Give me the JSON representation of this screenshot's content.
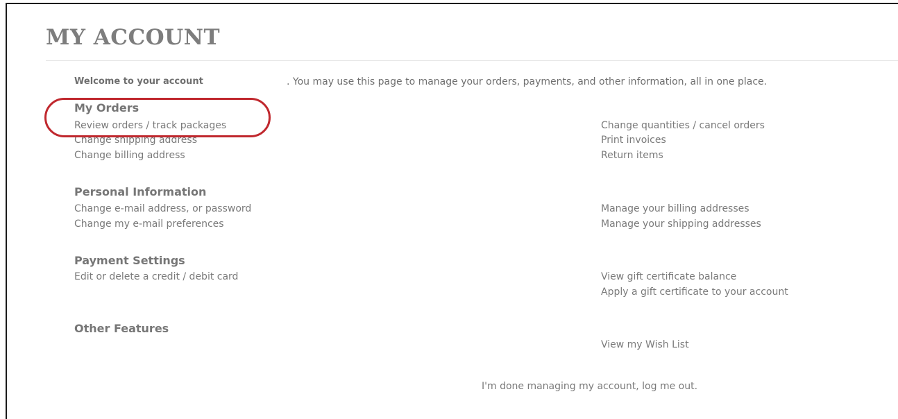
{
  "page": {
    "title": "MY ACCOUNT",
    "welcome_label": "Welcome to your account",
    "welcome_text": ". You may use this page to manage your orders, payments, and other information, all in one place."
  },
  "sections": {
    "orders": {
      "heading": "My Orders",
      "left": [
        "Review orders / track packages",
        "Change shipping address",
        "Change billing address"
      ],
      "right": [
        "Change quantities / cancel orders",
        "Print invoices",
        "Return items"
      ]
    },
    "personal": {
      "heading": "Personal Information",
      "left": [
        "Change e-mail address, or password",
        "Change my e-mail preferences"
      ],
      "right": [
        "Manage your billing addresses",
        "Manage your shipping addresses"
      ]
    },
    "payment": {
      "heading": "Payment Settings",
      "left": [
        "Edit or delete a credit / debit card"
      ],
      "right": [
        "View gift certificate balance",
        "Apply a gift certificate to your account"
      ]
    },
    "other": {
      "heading": "Other Features",
      "right": [
        "View my Wish List"
      ]
    }
  },
  "logout": {
    "label": "I'm done managing my account, log me out."
  },
  "colors": {
    "highlight": "#c0282e",
    "text": "#7a7a7a",
    "frame": "#1a1a1a"
  }
}
